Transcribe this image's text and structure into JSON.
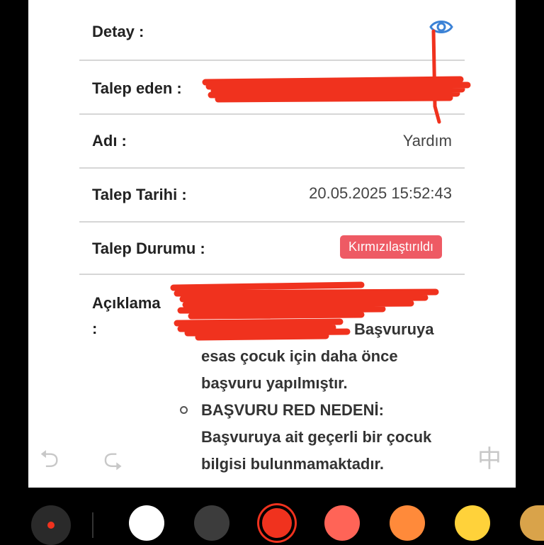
{
  "rows": {
    "detay": {
      "label": "Detay :"
    },
    "talep_eden": {
      "label": "Talep eden :"
    },
    "adi": {
      "label": "Adı :",
      "value": "Yardım"
    },
    "talep_tarihi": {
      "label": "Talep Tarihi :",
      "value": "20.05.2025 15:52:43"
    },
    "talep_durumu": {
      "label": "Talep Durumu :",
      "badge": "Kırmızılaştırıldı"
    }
  },
  "aciklama": {
    "label": "Açıklama :",
    "line1_suffix": "Başvuruya",
    "line2": "esas çocuk için daha önce",
    "line3": "başvuru yapılmıştır.",
    "bullet_line1": "BAŞVURU RED NEDENİ:",
    "bullet_line2": "Başvuruya ait geçerli bir çocuk",
    "bullet_line3": "bilgisi bulunmamaktadır."
  },
  "icons": {
    "detail_view": "eye-icon",
    "undo": "undo-icon",
    "redo": "redo-icon",
    "keyboard_lang": "chinese-character-icon"
  },
  "float_glyphs": {
    "keyboard_lang": "中"
  },
  "colors": {
    "badge": "#ee5a64",
    "annotation_red": "#f0321e",
    "eye": "#3b82d6",
    "palette": [
      "#ffffff",
      "#3c3c3c",
      "#f0321e",
      "#ff6457",
      "#ff8a3a",
      "#ffd23a",
      "#d9a34a"
    ]
  }
}
